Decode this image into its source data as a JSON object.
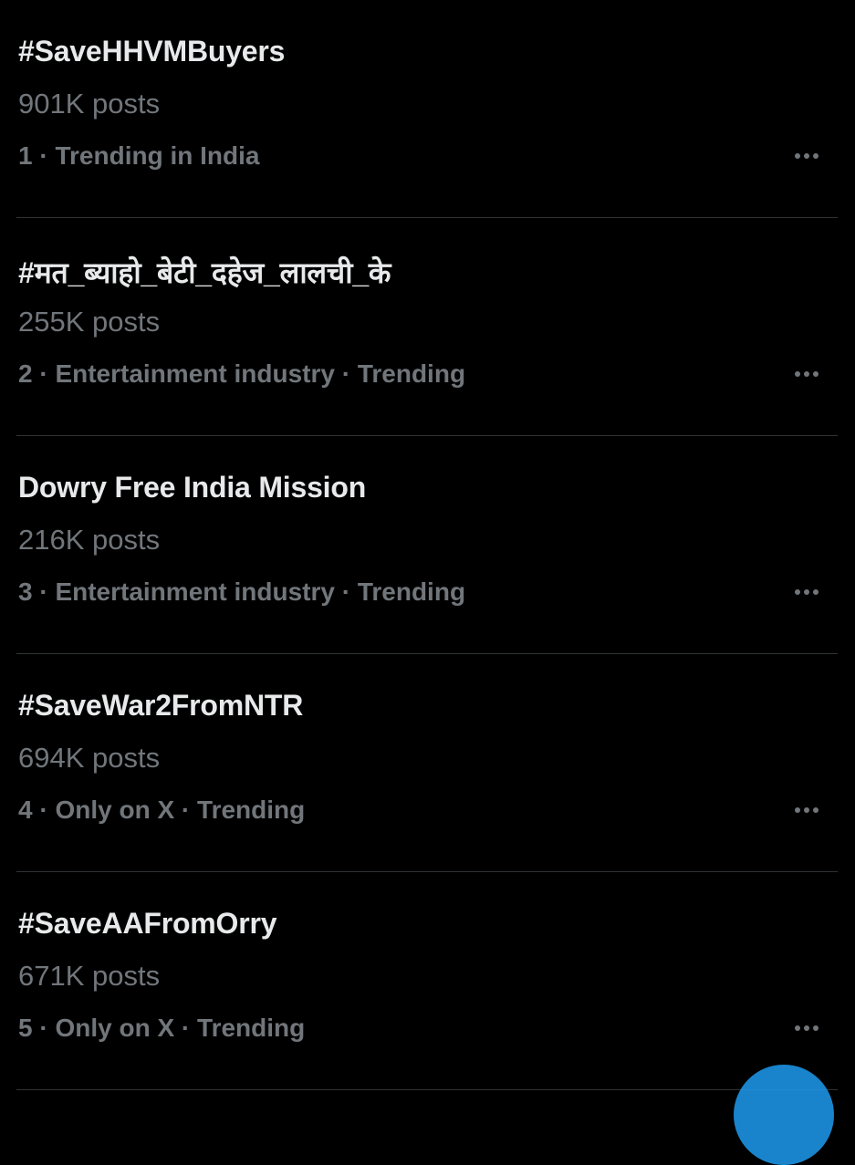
{
  "trends": [
    {
      "name": "#SaveHHVMBuyers",
      "posts": "901K posts",
      "meta": "1 · Trending in India"
    },
    {
      "name": "#मत_ब्याहो_बेटी_दहेज_लालची_के",
      "posts": "255K posts",
      "meta": "2 · Entertainment industry · Trending"
    },
    {
      "name": "Dowry Free India Mission",
      "posts": "216K posts",
      "meta": "3 · Entertainment industry · Trending"
    },
    {
      "name": "#SaveWar2FromNTR",
      "posts": "694K posts",
      "meta": "4 · Only on X · Trending"
    },
    {
      "name": "#SaveAAFromOrry",
      "posts": "671K posts",
      "meta": "5 · Only on X · Trending"
    }
  ],
  "icons": {
    "more": "more-horizontal-icon",
    "fab": "compose-post-icon"
  },
  "colors": {
    "background": "#000000",
    "primary_text": "#e7e9ea",
    "secondary_text": "#71767b",
    "divider": "#2f3336",
    "accent": "#1d9bf0"
  }
}
